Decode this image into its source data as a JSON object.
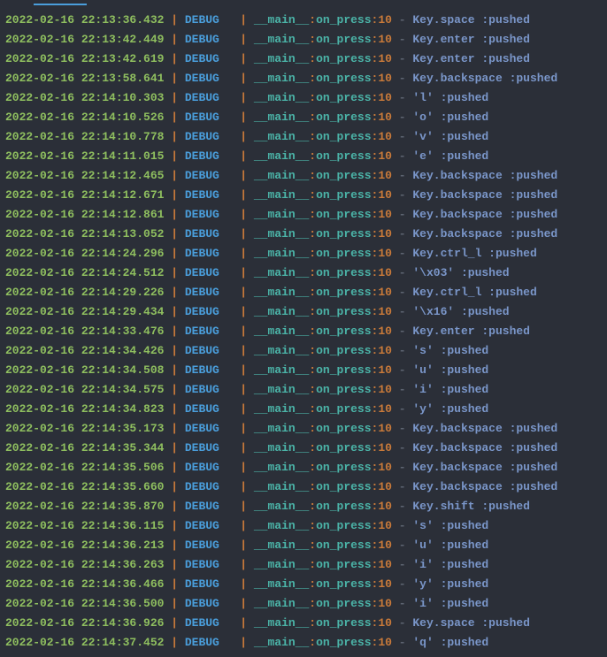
{
  "tab_active_index": 1,
  "log_format": {
    "level_field": "DEBUG",
    "module_field": "__main__",
    "func_field": "on_press",
    "lineno_field": "10",
    "pipe": "|",
    "colon": ":",
    "dash": "-"
  },
  "rows": [
    {
      "timestamp": "2022-02-16 22:13:36.432",
      "level": "DEBUG",
      "module": "__main__",
      "func": "on_press",
      "lineno": "10",
      "message": "Key.space :pushed"
    },
    {
      "timestamp": "2022-02-16 22:13:42.449",
      "level": "DEBUG",
      "module": "__main__",
      "func": "on_press",
      "lineno": "10",
      "message": "Key.enter :pushed"
    },
    {
      "timestamp": "2022-02-16 22:13:42.619",
      "level": "DEBUG",
      "module": "__main__",
      "func": "on_press",
      "lineno": "10",
      "message": "Key.enter :pushed"
    },
    {
      "timestamp": "2022-02-16 22:13:58.641",
      "level": "DEBUG",
      "module": "__main__",
      "func": "on_press",
      "lineno": "10",
      "message": "Key.backspace :pushed"
    },
    {
      "timestamp": "2022-02-16 22:14:10.303",
      "level": "DEBUG",
      "module": "__main__",
      "func": "on_press",
      "lineno": "10",
      "message": "'l' :pushed"
    },
    {
      "timestamp": "2022-02-16 22:14:10.526",
      "level": "DEBUG",
      "module": "__main__",
      "func": "on_press",
      "lineno": "10",
      "message": "'o' :pushed"
    },
    {
      "timestamp": "2022-02-16 22:14:10.778",
      "level": "DEBUG",
      "module": "__main__",
      "func": "on_press",
      "lineno": "10",
      "message": "'v' :pushed"
    },
    {
      "timestamp": "2022-02-16 22:14:11.015",
      "level": "DEBUG",
      "module": "__main__",
      "func": "on_press",
      "lineno": "10",
      "message": "'e' :pushed"
    },
    {
      "timestamp": "2022-02-16 22:14:12.465",
      "level": "DEBUG",
      "module": "__main__",
      "func": "on_press",
      "lineno": "10",
      "message": "Key.backspace :pushed"
    },
    {
      "timestamp": "2022-02-16 22:14:12.671",
      "level": "DEBUG",
      "module": "__main__",
      "func": "on_press",
      "lineno": "10",
      "message": "Key.backspace :pushed"
    },
    {
      "timestamp": "2022-02-16 22:14:12.861",
      "level": "DEBUG",
      "module": "__main__",
      "func": "on_press",
      "lineno": "10",
      "message": "Key.backspace :pushed"
    },
    {
      "timestamp": "2022-02-16 22:14:13.052",
      "level": "DEBUG",
      "module": "__main__",
      "func": "on_press",
      "lineno": "10",
      "message": "Key.backspace :pushed"
    },
    {
      "timestamp": "2022-02-16 22:14:24.296",
      "level": "DEBUG",
      "module": "__main__",
      "func": "on_press",
      "lineno": "10",
      "message": "Key.ctrl_l :pushed"
    },
    {
      "timestamp": "2022-02-16 22:14:24.512",
      "level": "DEBUG",
      "module": "__main__",
      "func": "on_press",
      "lineno": "10",
      "message": "'\\x03' :pushed"
    },
    {
      "timestamp": "2022-02-16 22:14:29.226",
      "level": "DEBUG",
      "module": "__main__",
      "func": "on_press",
      "lineno": "10",
      "message": "Key.ctrl_l :pushed"
    },
    {
      "timestamp": "2022-02-16 22:14:29.434",
      "level": "DEBUG",
      "module": "__main__",
      "func": "on_press",
      "lineno": "10",
      "message": "'\\x16' :pushed"
    },
    {
      "timestamp": "2022-02-16 22:14:33.476",
      "level": "DEBUG",
      "module": "__main__",
      "func": "on_press",
      "lineno": "10",
      "message": "Key.enter :pushed"
    },
    {
      "timestamp": "2022-02-16 22:14:34.426",
      "level": "DEBUG",
      "module": "__main__",
      "func": "on_press",
      "lineno": "10",
      "message": "'s' :pushed"
    },
    {
      "timestamp": "2022-02-16 22:14:34.508",
      "level": "DEBUG",
      "module": "__main__",
      "func": "on_press",
      "lineno": "10",
      "message": "'u' :pushed"
    },
    {
      "timestamp": "2022-02-16 22:14:34.575",
      "level": "DEBUG",
      "module": "__main__",
      "func": "on_press",
      "lineno": "10",
      "message": "'i' :pushed"
    },
    {
      "timestamp": "2022-02-16 22:14:34.823",
      "level": "DEBUG",
      "module": "__main__",
      "func": "on_press",
      "lineno": "10",
      "message": "'y' :pushed"
    },
    {
      "timestamp": "2022-02-16 22:14:35.173",
      "level": "DEBUG",
      "module": "__main__",
      "func": "on_press",
      "lineno": "10",
      "message": "Key.backspace :pushed"
    },
    {
      "timestamp": "2022-02-16 22:14:35.344",
      "level": "DEBUG",
      "module": "__main__",
      "func": "on_press",
      "lineno": "10",
      "message": "Key.backspace :pushed"
    },
    {
      "timestamp": "2022-02-16 22:14:35.506",
      "level": "DEBUG",
      "module": "__main__",
      "func": "on_press",
      "lineno": "10",
      "message": "Key.backspace :pushed"
    },
    {
      "timestamp": "2022-02-16 22:14:35.660",
      "level": "DEBUG",
      "module": "__main__",
      "func": "on_press",
      "lineno": "10",
      "message": "Key.backspace :pushed"
    },
    {
      "timestamp": "2022-02-16 22:14:35.870",
      "level": "DEBUG",
      "module": "__main__",
      "func": "on_press",
      "lineno": "10",
      "message": "Key.shift :pushed"
    },
    {
      "timestamp": "2022-02-16 22:14:36.115",
      "level": "DEBUG",
      "module": "__main__",
      "func": "on_press",
      "lineno": "10",
      "message": "'s' :pushed"
    },
    {
      "timestamp": "2022-02-16 22:14:36.213",
      "level": "DEBUG",
      "module": "__main__",
      "func": "on_press",
      "lineno": "10",
      "message": "'u' :pushed"
    },
    {
      "timestamp": "2022-02-16 22:14:36.263",
      "level": "DEBUG",
      "module": "__main__",
      "func": "on_press",
      "lineno": "10",
      "message": "'i' :pushed"
    },
    {
      "timestamp": "2022-02-16 22:14:36.466",
      "level": "DEBUG",
      "module": "__main__",
      "func": "on_press",
      "lineno": "10",
      "message": "'y' :pushed"
    },
    {
      "timestamp": "2022-02-16 22:14:36.500",
      "level": "DEBUG",
      "module": "__main__",
      "func": "on_press",
      "lineno": "10",
      "message": "'i' :pushed"
    },
    {
      "timestamp": "2022-02-16 22:14:36.926",
      "level": "DEBUG",
      "module": "__main__",
      "func": "on_press",
      "lineno": "10",
      "message": "Key.space :pushed"
    },
    {
      "timestamp": "2022-02-16 22:14:37.452",
      "level": "DEBUG",
      "module": "__main__",
      "func": "on_press",
      "lineno": "10",
      "message": "'q' :pushed"
    }
  ]
}
